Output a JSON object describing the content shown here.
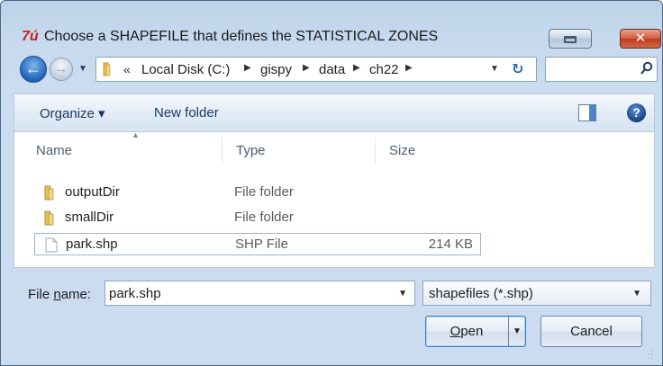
{
  "window": {
    "app_icon_text": "7ú",
    "title": "Choose a SHAPEFILE that defines the STATISTICAL ZONES",
    "close_label": "✕"
  },
  "address": {
    "chevrons": "«",
    "crumbs": [
      "Local Disk (C:)",
      "gispy",
      "data",
      "ch22"
    ]
  },
  "search": {
    "placeholder": ""
  },
  "toolbar": {
    "organize_label": "Organize ▾",
    "new_folder_label": "New folder",
    "help_label": "?"
  },
  "file_list": {
    "columns": [
      "Name",
      "Type",
      "Size"
    ],
    "rows": [
      {
        "name": "outputDir",
        "type": "File folder",
        "size": "",
        "icon": "folder-icon"
      },
      {
        "name": "smallDir",
        "type": "File folder",
        "size": "",
        "icon": "folder-icon"
      },
      {
        "name": "park.shp",
        "type": "SHP File",
        "size": "214 KB",
        "icon": "file-icon",
        "selected": true
      }
    ]
  },
  "bottom": {
    "filename_label_pre": "File ",
    "filename_label_key": "n",
    "filename_label_post": "ame:",
    "filename_value": "park.shp",
    "filter_value": "shapefiles (*.shp)",
    "open_label_key": "O",
    "open_label_rest": "pen",
    "cancel_label": "Cancel"
  },
  "colors": {
    "accent": "#2a66b8",
    "close_red": "#c03a1e",
    "folder_yellow": "#e9c25a"
  }
}
